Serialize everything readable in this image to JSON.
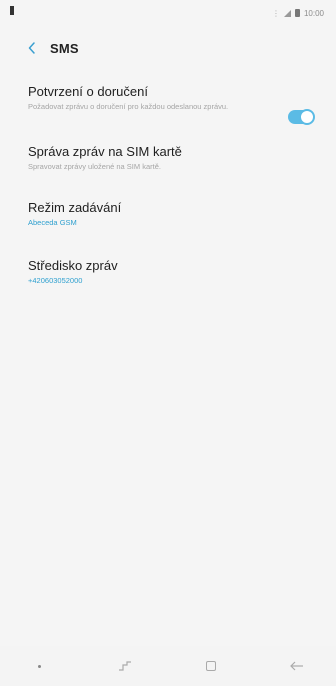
{
  "status_bar": {
    "time": "10:00"
  },
  "app_bar": {
    "title": "SMS"
  },
  "settings": {
    "items": [
      {
        "title": "Potvrzení o doručení",
        "subtitle": "Požadovat zprávu o doručení pro každou odeslanou zprávu.",
        "toggle_on": true
      },
      {
        "title": "Správa zpráv na SIM kartě",
        "subtitle": "Spravovat zprávy uložené na SIM kartě."
      },
      {
        "title": "Režim zadávání",
        "subtitle": "Abeceda GSM"
      },
      {
        "title": "Středisko zpráv",
        "subtitle": "+420603052000"
      }
    ]
  },
  "colors": {
    "accent": "#2fa0cf",
    "toggle": "#5bbbe5",
    "background": "#f5f5f5"
  },
  "nav_bar": {
    "icons": [
      "indicator-dot-icon",
      "recent-apps-icon",
      "home-icon",
      "back-arrow-icon"
    ]
  }
}
